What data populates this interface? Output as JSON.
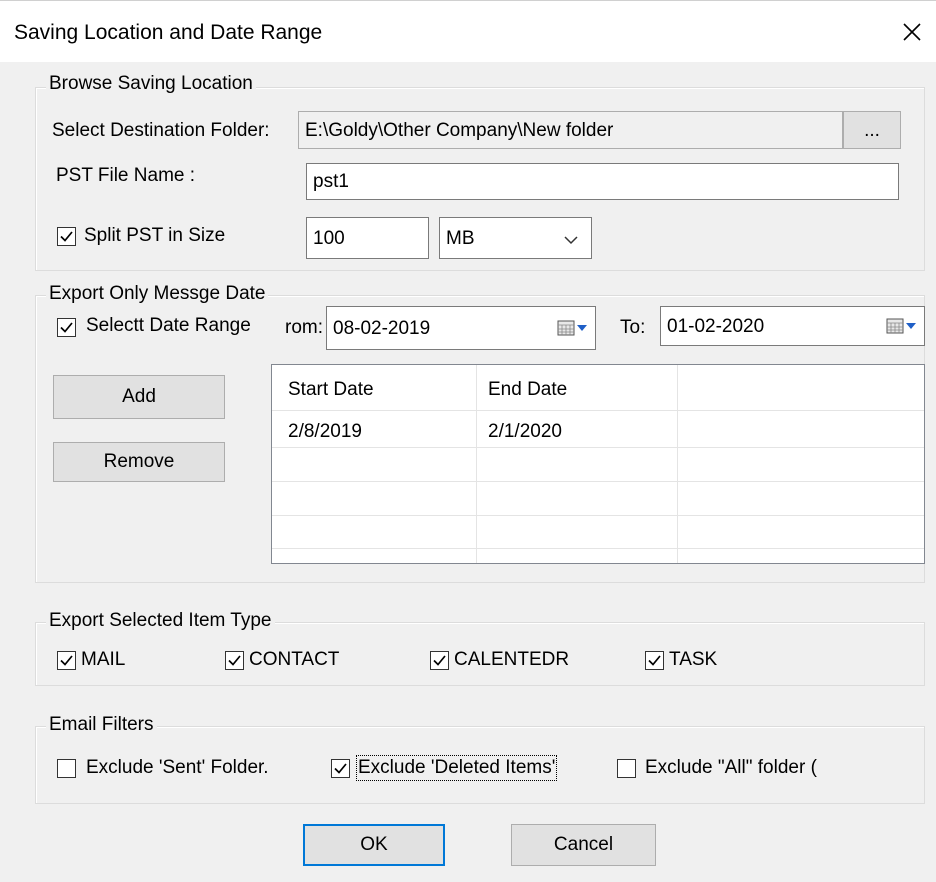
{
  "window": {
    "title": "Saving Location and Date Range"
  },
  "browse": {
    "legend": "Browse Saving Location",
    "dest_label": "Select Destination Folder:",
    "dest_value": "E:\\Goldy\\Other Company\\New folder",
    "browse_btn": "...",
    "pst_label": "PST File Name :",
    "pst_value": "pst1",
    "split_label": "Split PST in Size",
    "split_checked": true,
    "size_value": "100",
    "unit_value": "MB"
  },
  "dates": {
    "legend": "Export Only Messge Date",
    "range_label": "Selectt Date Range",
    "range_checked": true,
    "from_label": "rom:",
    "from_value": "08-02-2019",
    "to_label": "To:",
    "to_value": "01-02-2020",
    "add_btn": "Add",
    "remove_btn": "Remove",
    "columns": [
      "Start Date",
      "End Date"
    ],
    "rows": [
      {
        "start": "2/8/2019",
        "end": "2/1/2020"
      }
    ]
  },
  "item_types": {
    "legend": "Export Selected Item Type",
    "items": [
      {
        "label": "MAIL",
        "checked": true
      },
      {
        "label": "CONTACT",
        "checked": true
      },
      {
        "label": "CALENTEDR",
        "checked": true
      },
      {
        "label": "TASK",
        "checked": true
      }
    ]
  },
  "filters": {
    "legend": "Email Filters",
    "items": [
      {
        "label": "Exclude 'Sent' Folder.",
        "checked": false
      },
      {
        "label": "Exclude 'Deleted Items'",
        "checked": true
      },
      {
        "label": "Exclude \"All\" folder (",
        "checked": false
      }
    ]
  },
  "footer": {
    "ok": "OK",
    "cancel": "Cancel"
  }
}
